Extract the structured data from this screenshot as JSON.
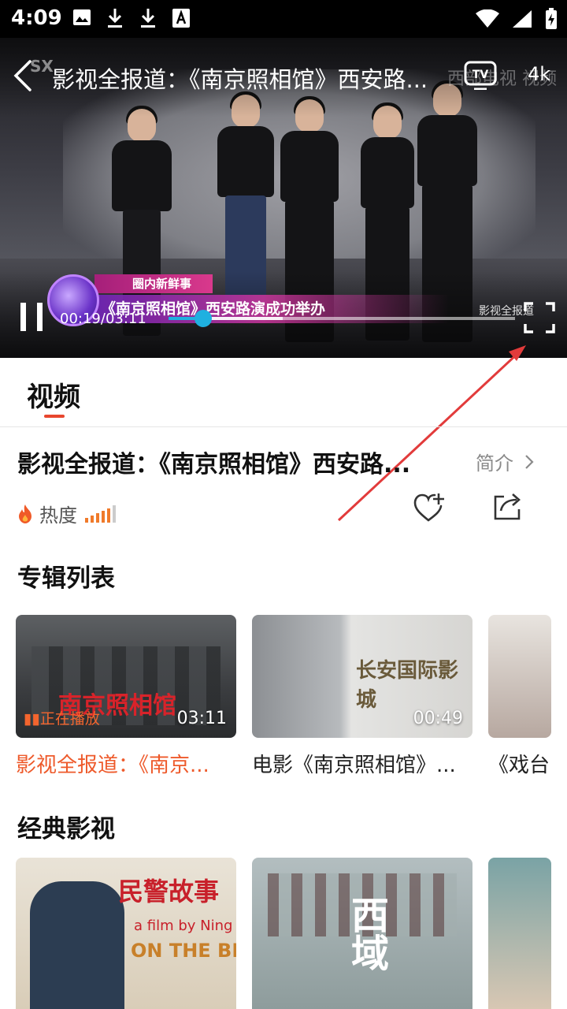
{
  "status_bar": {
    "time": "4:09",
    "icons": [
      "image-icon",
      "download-icon",
      "download-icon",
      "text-a-icon",
      "wifi-icon",
      "signal-icon",
      "battery-charging-icon"
    ]
  },
  "player": {
    "title": "影视全报道：《南京照相馆》西安路...",
    "channel_logo": "SX",
    "watermark": "西部电视 视频",
    "quality": "4k",
    "lower_third_tag": "圈内新鲜事",
    "lower_third_text": "《南京照相馆》西安路演成功举办",
    "brand_mark": "影视全报道",
    "current_time": "00:19",
    "duration": "03:11",
    "progress_played": 0.1,
    "progress_buffered": 0.33
  },
  "tabs": {
    "video": "视频"
  },
  "detail": {
    "title": "影视全报道：《南京照相馆》西安路...",
    "intro_label": "简介",
    "heat_label": "热度"
  },
  "album": {
    "section_title": "专辑列表",
    "items": [
      {
        "caption": "影视全报道：《南京...",
        "duration": "03:11",
        "playing_label": "正在播放",
        "thumb_text": "南京照相馆"
      },
      {
        "caption": "电影《南京照相馆》...",
        "duration": "00:49",
        "thumb_text": "长安国际影城"
      },
      {
        "caption": "《戏台",
        "duration": ""
      }
    ]
  },
  "classic": {
    "section_title": "经典影视",
    "items": [
      {
        "poster_title": "民警故事",
        "poster_sub": "a film by Ning Y",
        "poster_sub2": "ON THE BE"
      },
      {
        "poster_title": "西域"
      },
      {
        "poster_title": ""
      }
    ]
  },
  "colors": {
    "accent": "#ee5a2b",
    "progress": "#1fb0e0"
  }
}
